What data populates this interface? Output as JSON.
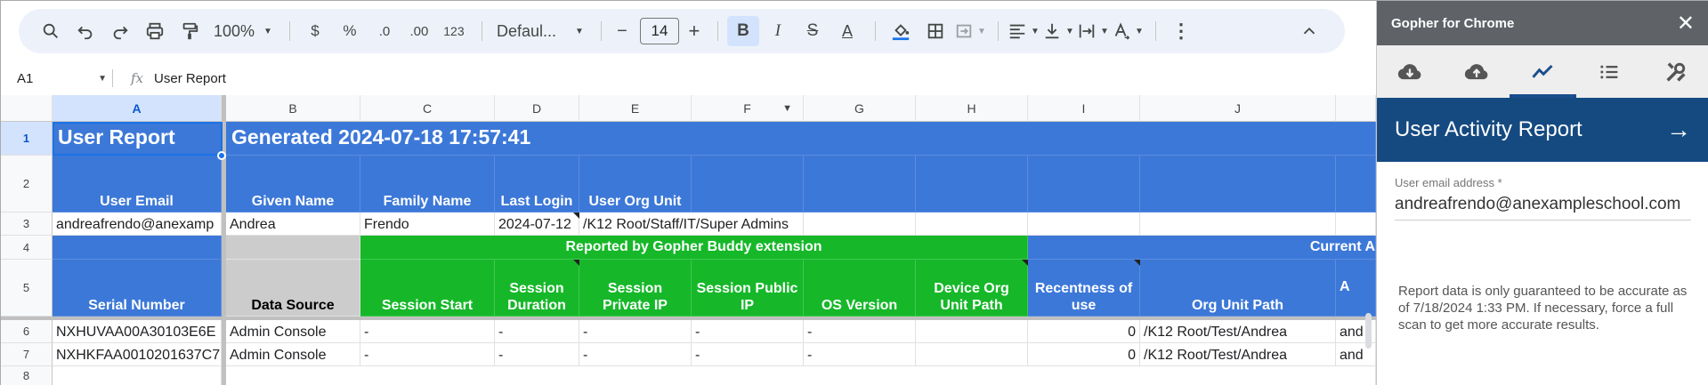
{
  "toolbar": {
    "zoom": "100%",
    "currency": "$",
    "percent": "%",
    "dec_decrease": ".0",
    "dec_increase": ".00",
    "number_format": "123",
    "font": "Defaul...",
    "font_size": "14",
    "minus": "−",
    "plus": "+",
    "bold": "B",
    "italic": "I",
    "strike": "S",
    "text_color": "A"
  },
  "formula_bar": {
    "cell_ref": "A1",
    "fx": "fx",
    "content": "User Report"
  },
  "columns": [
    "A",
    "B",
    "C",
    "D",
    "E",
    "F",
    "G",
    "H",
    "I",
    "J"
  ],
  "rows": [
    "1",
    "2",
    "3",
    "4",
    "5",
    "6",
    "7",
    "8"
  ],
  "sheet": {
    "title": "User Report",
    "generated": "Generated 2024-07-18 17:57:41",
    "header2": {
      "user_email": "User Email",
      "given_name": "Given Name",
      "family_name": "Family Name",
      "last_login": "Last Login",
      "user_org_unit": "User Org Unit"
    },
    "row3": {
      "email": "andreafrendo@anexamp",
      "given": "Andrea",
      "family": "Frendo",
      "login": "2024-07-12",
      "ou": "/K12 Root/Staff/IT/Super Admins"
    },
    "row4": {
      "gopher": "Reported by Gopher Buddy extension",
      "current": "Current A"
    },
    "header5": {
      "serial": "Serial Number",
      "data_source": "Data Source",
      "session_start": "Session Start",
      "session_duration": "Session Duration",
      "session_private_ip": "Session Private IP",
      "session_public_ip": "Session Public IP",
      "os_version": "OS Version",
      "device_ou_path": "Device Org Unit Path",
      "recentness": "Recentness of use",
      "org_unit_path": "Org Unit Path",
      "k_partial": "A"
    },
    "data_rows": [
      {
        "serial": "NXHUVAA00A30103E6E",
        "source": "Admin Console",
        "start": "-",
        "duration": "-",
        "private_ip": "-",
        "public_ip": "-",
        "os": "-",
        "device_ou": "",
        "recent": "0",
        "ou_path": "/K12 Root/Test/Andrea",
        "k": "and"
      },
      {
        "serial": "NXHKFAA0010201637C7",
        "source": "Admin Console",
        "start": "-",
        "duration": "-",
        "private_ip": "-",
        "public_ip": "-",
        "os": "-",
        "device_ou": "",
        "recent": "0",
        "ou_path": "/K12 Root/Test/Andrea",
        "k": "and"
      }
    ]
  },
  "panel": {
    "app_title": "Gopher for Chrome",
    "close": "✕",
    "tabs": [
      "cloud-download-icon",
      "cloud-upload-icon",
      "activity-chart-icon",
      "list-icon",
      "tools-icon"
    ],
    "heading": "User Activity Report",
    "arrow": "→",
    "field_label": "User email address *",
    "field_value": "andreafrendo@anexampleschool.com",
    "note": "Report data is only guaranteed to be accurate as of 7/18/2024 1:33 PM. If necessary, force a full scan to get more accurate results."
  },
  "colors": {
    "header_blue": "#3c78d8",
    "gopher_green": "#16b829",
    "panel_navy": "#154a80",
    "panel_gray": "#5f6368"
  }
}
